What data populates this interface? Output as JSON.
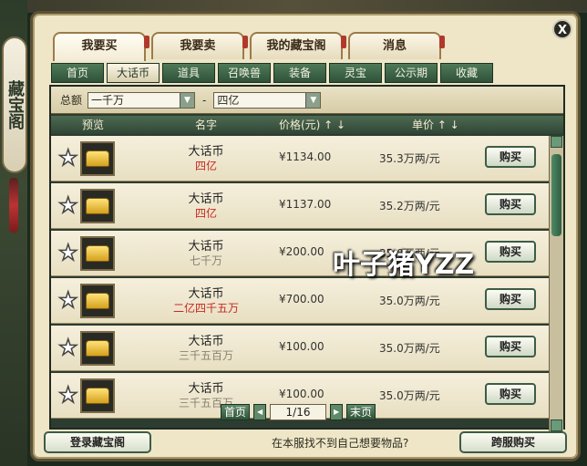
{
  "side_badge": "藏宝阁",
  "window": {
    "close_label": "X",
    "top_tabs": [
      {
        "label": "我要买",
        "active": true
      },
      {
        "label": "我要卖",
        "active": false
      },
      {
        "label": "我的藏宝阁",
        "active": false
      },
      {
        "label": "消息",
        "active": false
      }
    ],
    "sub_tabs": [
      {
        "label": "首页",
        "active": false
      },
      {
        "label": "大话币",
        "active": true
      },
      {
        "label": "道具",
        "active": false
      },
      {
        "label": "召唤兽",
        "active": false
      },
      {
        "label": "装备",
        "active": false
      },
      {
        "label": "灵宝",
        "active": false
      },
      {
        "label": "公示期",
        "active": false
      },
      {
        "label": "收藏",
        "active": false
      }
    ],
    "filter": {
      "label": "总额",
      "min": "一千万",
      "max": "四亿",
      "separator": "-"
    },
    "table_headers": {
      "preview": "预览",
      "name": "名字",
      "price": "价格(元) ↑ ↓",
      "unit": "单价 ↑ ↓"
    },
    "rows": [
      {
        "name": "大话币",
        "amount": "四亿",
        "amount_grey": false,
        "price": "¥1134.00",
        "unit": "35.3万两/元",
        "buy": "购买"
      },
      {
        "name": "大话币",
        "amount": "四亿",
        "amount_grey": false,
        "price": "¥1137.00",
        "unit": "35.2万两/元",
        "buy": "购买"
      },
      {
        "name": "大话币",
        "amount": "七千万",
        "amount_grey": true,
        "price": "¥200.00",
        "unit": "35.0万两/元",
        "buy": "购买"
      },
      {
        "name": "大话币",
        "amount": "二亿四千五万",
        "amount_grey": false,
        "price": "¥700.00",
        "unit": "35.0万两/元",
        "buy": "购买"
      },
      {
        "name": "大话币",
        "amount": "三千五百万",
        "amount_grey": true,
        "price": "¥100.00",
        "unit": "35.0万两/元",
        "buy": "购买"
      },
      {
        "name": "大话币",
        "amount": "三千五百万",
        "amount_grey": true,
        "price": "¥100.00",
        "unit": "35.0万两/元",
        "buy": "购买"
      }
    ],
    "pager": {
      "first": "首页",
      "last": "末页",
      "page": "1/16"
    },
    "bottom": {
      "login": "登录藏宝阁",
      "hint": "在本服找不到自己想要物品?",
      "cross_buy": "跨服购买"
    }
  },
  "watermark": "叶子猪YZZ"
}
